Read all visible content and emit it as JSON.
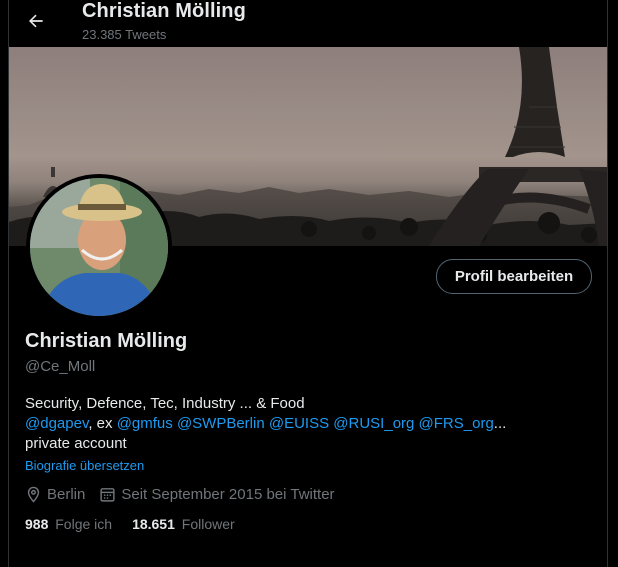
{
  "header": {
    "back_label": "Back",
    "name": "Christian Mölling",
    "tweet_count": "23.385 Tweets"
  },
  "profile": {
    "name": "Christian Mölling",
    "handle": "@Ce_Moll",
    "edit_button": "Profil bearbeiten",
    "bio": {
      "line1": "Security, Defence, Tec, Industry ... & Food",
      "mention_dgapev": "@dgapev",
      "sep_ex": ", ex ",
      "mention_gmfus": "@gmfus",
      "mention_swp": "@SWPBerlin",
      "mention_euiss": "@EUISS",
      "mention_rusi": "@RUSI_org",
      "mention_frs": "@FRS_org",
      "ellipsis": "...",
      "line3": "private account"
    },
    "translate_link": "Biografie übersetzen",
    "location": "Berlin",
    "joined": "Seit September 2015 bei Twitter",
    "following_count": "988",
    "following_label": "Folge ich",
    "followers_count": "18.651",
    "followers_label": "Follower"
  },
  "colors": {
    "background": "#000000",
    "text": "#e7e9ea",
    "muted": "#71767b",
    "link": "#1d9bf0",
    "border": "#2f3336"
  }
}
